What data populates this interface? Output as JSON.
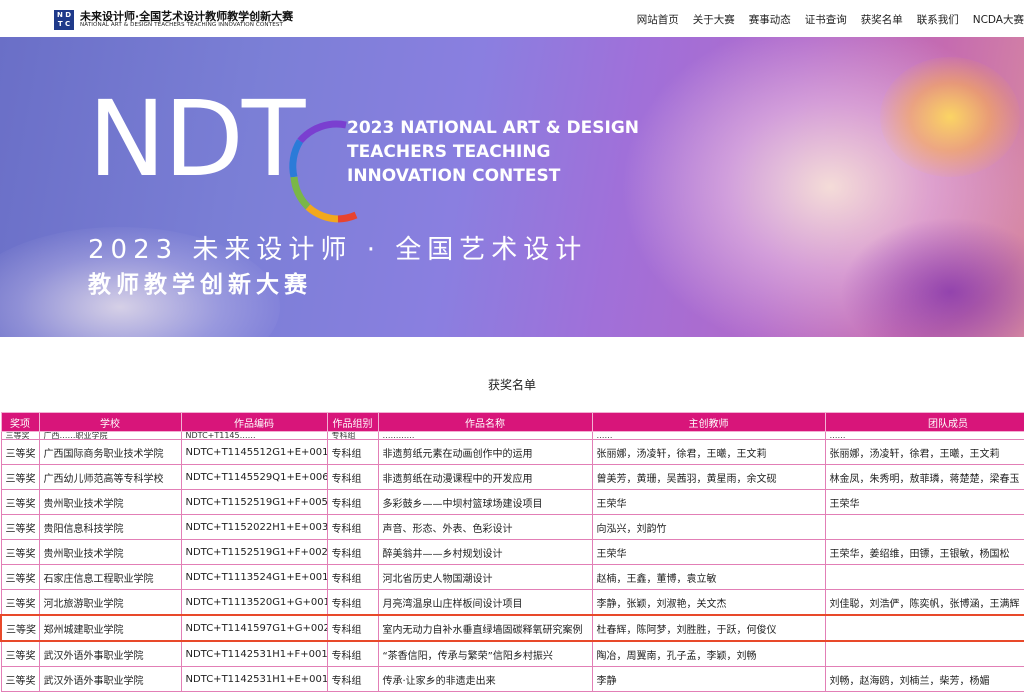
{
  "header": {
    "logo_mark": "NDTC",
    "logo_cn": "未来设计师·全国艺术设计教师教学创新大赛",
    "logo_en": "NATIONAL ART & DESIGN TEACHERS TEACHING INNOVATION CONTEST",
    "nav": [
      "网站首页",
      "关于大赛",
      "赛事动态",
      "证书查询",
      "获奖名单",
      "联系我们",
      "NCDA大赛"
    ]
  },
  "banner": {
    "big_text": "NDTC",
    "en_line1": "2023 NATIONAL ART & DESIGN",
    "en_line2": "TEACHERS TEACHING",
    "en_line3": "INNOVATION CONTEST",
    "cn_line1": "2023 未来设计师 · 全国艺术设计",
    "cn_line2": "教师教学创新大赛",
    "ring_colors": [
      "#2b7bd8",
      "#7a3fd0",
      "#e8432f",
      "#f2a81d",
      "#7ab648"
    ]
  },
  "section_title": "获奖名单",
  "table": {
    "headers": [
      "奖项",
      "学校",
      "作品编码",
      "作品组别",
      "作品名称",
      "主创教师",
      "团队成员"
    ],
    "partial_row": [
      "三等奖",
      "广西……职业学院",
      "NDTC+T1145……",
      "专科组",
      "…………",
      "……",
      "……"
    ],
    "rows": [
      [
        "三等奖",
        "广西国际商务职业技术学院",
        "NDTC+T1145512G1+E+001",
        "专科组",
        "非遗剪纸元素在动画创作中的运用",
        "张丽娜，汤凌轩，徐君，王曦，王文莉",
        "张丽娜，汤凌轩，徐君，王曦，王文莉"
      ],
      [
        "三等奖",
        "广西幼儿师范高等专科学校",
        "NDTC+T1145529Q1+E+006",
        "专科组",
        "非遗剪纸在动漫课程中的开发应用",
        "曾美芳，黄珊，吴茜羽，黄星雨，余文砚",
        "林金凤，朱秀明，敖菲璘，蒋楚楚，梁春玉"
      ],
      [
        "三等奖",
        "贵州职业技术学院",
        "NDTC+T1152519G1+F+005",
        "专科组",
        "多彩鼓乡——中坝村篮球场建设项目",
        "王荣华",
        "王荣华"
      ],
      [
        "三等奖",
        "贵阳信息科技学院",
        "NDTC+T1152022H1+E+003",
        "专科组",
        "声音、形态、外表、色彩设计",
        "向泓兴，刘韵竹",
        ""
      ],
      [
        "三等奖",
        "贵州职业技术学院",
        "NDTC+T1152519G1+F+002",
        "专科组",
        "醉美翁井——乡村规划设计",
        "王荣华",
        "王荣华，姜绍维，田镖，王银敏，杨国松"
      ],
      [
        "三等奖",
        "石家庄信息工程职业学院",
        "NDTC+T1113524G1+E+001",
        "专科组",
        "河北省历史人物国潮设计",
        "赵楠，王鑫，董博，袁立敏",
        ""
      ],
      [
        "三等奖",
        "河北旅游职业学院",
        "NDTC+T1113520G1+G+001",
        "专科组",
        "月亮湾温泉山庄样板间设计项目",
        "李静，张颖，刘淑艳，关文杰",
        "刘佳聪，刘浩俨，陈奕帆，张博涵，王满辉"
      ],
      [
        "三等奖",
        "郑州城建职业学院",
        "NDTC+T1141597G1+G+002",
        "专科组",
        "室内无动力自补水垂直绿墙固碳释氧研究案例",
        "杜春辉，陈阿梦，刘胜胜，于跃，何俊仪",
        ""
      ],
      [
        "三等奖",
        "武汉外语外事职业学院",
        "NDTC+T1142531H1+F+001",
        "专科组",
        "“茶香信阳，传承与繁荣”信阳乡村振兴",
        "陶冶，周翼南，孔子孟，李颖，刘畅",
        ""
      ],
      [
        "三等奖",
        "武汉外语外事职业学院",
        "NDTC+T1142531H1+E+001",
        "专科组",
        "传承·让家乡的非遗走出来",
        "李静",
        "刘畅，赵海鸥，刘楠兰，柴芳，杨媚"
      ]
    ]
  }
}
